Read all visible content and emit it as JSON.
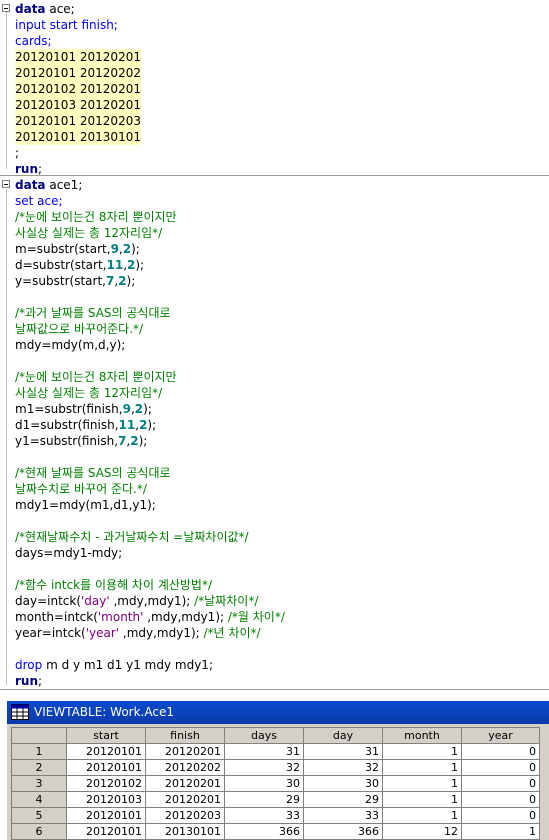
{
  "editor": {
    "block1": {
      "l1_kw": "data",
      "l1_rest": " ace;",
      "l2": "input start finish;",
      "l3": "cards;",
      "data_lines": [
        "20120101 20120201",
        "20120101 20120202",
        "20120102 20120201",
        "20120103 20120201",
        "20120101 20120203",
        "20120101 20130101"
      ],
      "l10": ";",
      "run": "run",
      "run_semi": ";"
    },
    "block2": {
      "l1_kw": "data",
      "l1_rest": " ace1;",
      "set": "set ace;",
      "c1a": "/*눈에 보이는건 8자리 뿐이지만",
      "c1b": "사실상 실제는 총 12자리임*/",
      "m_pre": "m=substr(start,",
      "m_n1": "9",
      "m_c": ",",
      "m_n2": "2",
      "m_post": ");",
      "d_pre": "d=substr(start,",
      "d_n1": "11",
      "d_c": ",",
      "d_n2": "2",
      "d_post": ");",
      "y_pre": "y=substr(start,",
      "y_n1": "7",
      "y_c": ",",
      "y_n2": "2",
      "y_post": ");",
      "c2a": "/*과거 날짜를 SAS의 공식대로",
      "c2b": "날짜값으로 바꾸어준다.*/",
      "mdy": "mdy=mdy(m,d,y);",
      "c3a": "/*눈에 보이는건 8자리 뿐이지만",
      "c3b": "사실상 실제는 총 12자리임*/",
      "m1_pre": "m1=substr(finish,",
      "m1_n1": "9",
      "m1_c": ",",
      "m1_n2": "2",
      "m1_post": ");",
      "d1_pre": "d1=substr(finish,",
      "d1_n1": "11",
      "d1_c": ",",
      "d1_n2": "2",
      "d1_post": ");",
      "y1_pre": "y1=substr(finish,",
      "y1_n1": "7",
      "y1_c": ",",
      "y1_n2": "2",
      "y1_post": ");",
      "c4a": "/*현재 날짜를 SAS의 공식대로",
      "c4b": "날짜수치로 바꾸어 준다.*/",
      "mdy1": "mdy1=mdy(m1,d1,y1);",
      "c5": "/*현재날짜수치 - 과거날짜수치 =날짜차이값*/",
      "days": "days=mdy1-mdy;",
      "c6": "/*함수 intck를 이용해 차이 계산방법*/",
      "day_pre": "day=intck(",
      "day_str": "'day'",
      "day_post": " ,mdy,mdy1); ",
      "day_cmt": "/*날짜차이*/",
      "month_pre": "month=intck(",
      "month_str": "'month'",
      "month_post": " ,mdy,mdy1); ",
      "month_cmt": "/*월 차이*/",
      "year_pre": "year=intck(",
      "year_str": "'year'",
      "year_post": " ,mdy,mdy1); ",
      "year_cmt": "/*년 차이*/",
      "drop_kw": "drop",
      "drop_rest": " m d y m1 d1 y1 mdy mdy1;",
      "run": "run",
      "run_semi": ";"
    }
  },
  "viewtable": {
    "title": "VIEWTABLE: Work.Ace1",
    "columns": [
      "start",
      "finish",
      "days",
      "day",
      "month",
      "year"
    ],
    "rows": [
      {
        "n": "1",
        "start": "20120101",
        "finish": "20120201",
        "days": "31",
        "day": "31",
        "month": "1",
        "year": "0"
      },
      {
        "n": "2",
        "start": "20120101",
        "finish": "20120202",
        "days": "32",
        "day": "32",
        "month": "1",
        "year": "0"
      },
      {
        "n": "3",
        "start": "20120102",
        "finish": "20120201",
        "days": "30",
        "day": "30",
        "month": "1",
        "year": "0"
      },
      {
        "n": "4",
        "start": "20120103",
        "finish": "20120201",
        "days": "29",
        "day": "29",
        "month": "1",
        "year": "0"
      },
      {
        "n": "5",
        "start": "20120101",
        "finish": "20120203",
        "days": "33",
        "day": "33",
        "month": "1",
        "year": "0"
      },
      {
        "n": "6",
        "start": "20120101",
        "finish": "20130101",
        "days": "366",
        "day": "366",
        "month": "12",
        "year": "1"
      }
    ]
  },
  "colors": {
    "keyword": "#000080",
    "comment": "#008000",
    "number": "#008080",
    "string": "#800080",
    "datalines": "#ffffc0",
    "titlebar": "#0a3aa8"
  }
}
